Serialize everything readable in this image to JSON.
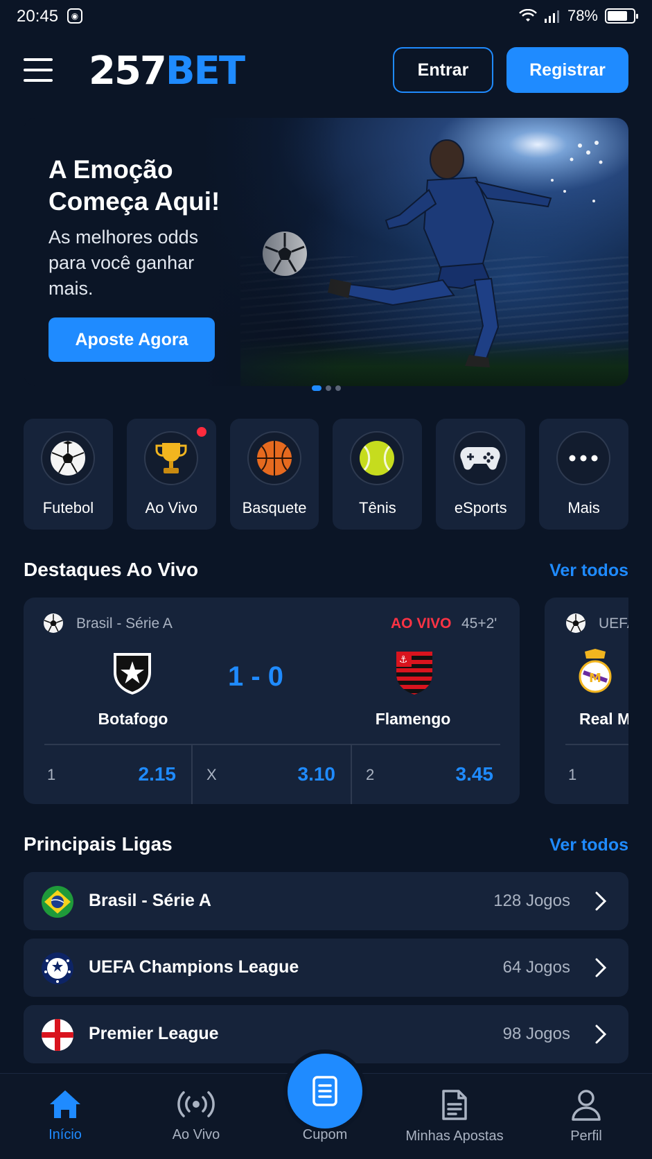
{
  "status_bar": {
    "time": "20:45",
    "battery": "78%",
    "battery_level": 0.78
  },
  "header": {
    "logo_number": "257",
    "logo_brand": "BET",
    "login_label": "Entrar",
    "register_label": "Registrar"
  },
  "hero": {
    "title": "A Emoção Começa Aqui!",
    "subtitle": "As melhores odds para você ganhar mais.",
    "cta_label": "Aposte Agora",
    "carousel_active": 1,
    "carousel_count": 3
  },
  "sports": [
    {
      "label": "Futebol",
      "icon": "soccer-ball-icon"
    },
    {
      "label": "Ao Vivo",
      "icon": "trophy-icon",
      "notification": true
    },
    {
      "label": "Basquete",
      "icon": "basketball-icon"
    },
    {
      "label": "Tênis",
      "icon": "tennis-ball-icon"
    },
    {
      "label": "eSports",
      "icon": "gamepad-icon"
    },
    {
      "label": "Mais",
      "icon": "more-dots-icon"
    }
  ],
  "live": {
    "title": "Destaques Ao Vivo",
    "see_all": "Ver todos",
    "match": {
      "league": "Brasil - Série A",
      "status": "AO VIVO",
      "minute": "45+2'",
      "score": "1 - 0",
      "home": "Botafogo",
      "away": "Flamengo",
      "odds": [
        {
          "key": "1",
          "value": "2.15"
        },
        {
          "key": "X",
          "value": "3.10"
        },
        {
          "key": "2",
          "value": "3.45"
        }
      ]
    },
    "next_match": {
      "league": "UEFA",
      "home": "Real M",
      "odd_key": "1"
    }
  },
  "leagues": {
    "title": "Principais Ligas",
    "see_all": "Ver todos",
    "items": [
      {
        "name": "Brasil - Série A",
        "count": "128 Jogos",
        "flag": "brazil-flag-icon"
      },
      {
        "name": "UEFA Champions League",
        "count": "64 Jogos",
        "flag": "champions-league-icon"
      },
      {
        "name": "Premier League",
        "count": "98 Jogos",
        "flag": "england-flag-icon"
      }
    ]
  },
  "bottom_nav": {
    "home": "Início",
    "live": "Ao Vivo",
    "coupon": "Cupom",
    "bets": "Minhas Apostas",
    "profile": "Perfil"
  },
  "colors": {
    "accent": "#1f8bff",
    "background": "#0b1526",
    "card": "#16233a",
    "live_red": "#ff3344"
  }
}
